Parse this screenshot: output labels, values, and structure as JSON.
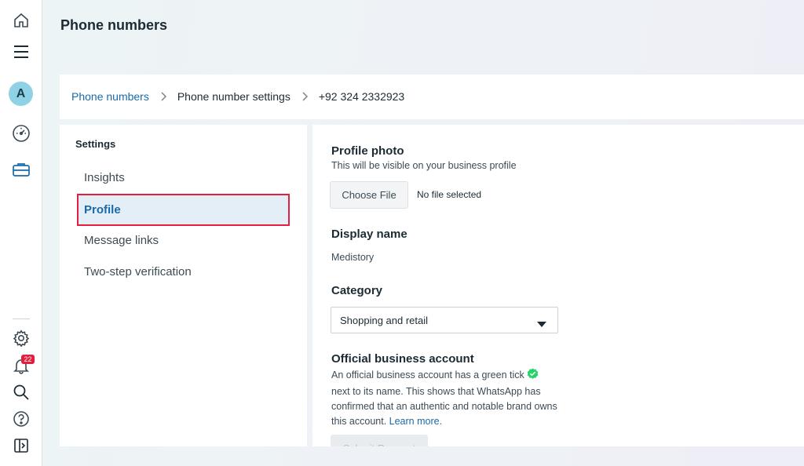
{
  "header": {
    "title": "Phone numbers"
  },
  "rail": {
    "avatar_initial": "A",
    "notification_count": "22"
  },
  "breadcrumb": {
    "items": [
      "Phone numbers",
      "Phone number settings",
      "+92 324 2332923"
    ]
  },
  "settings": {
    "heading": "Settings",
    "items": [
      {
        "label": "Insights"
      },
      {
        "label": "Profile",
        "active": true
      },
      {
        "label": "Message links"
      },
      {
        "label": "Two-step verification"
      }
    ]
  },
  "profile": {
    "photo": {
      "title": "Profile photo",
      "description": "This will be visible on your business profile",
      "choose_file_label": "Choose File",
      "file_status": "No file selected"
    },
    "display_name": {
      "title": "Display name",
      "value": "Medistory"
    },
    "category": {
      "title": "Category",
      "selected": "Shopping and retail"
    },
    "official": {
      "title": "Official business account",
      "description_part1": "An official business account has a green tick",
      "description_part2": " next to its name. This shows that WhatsApp has confirmed that an authentic and notable brand owns this account. ",
      "learn_more": "Learn more.",
      "submit_label": "Submit Request"
    }
  },
  "colors": {
    "accent_blue": "#1a6aa8",
    "highlight_red": "#e41e3f",
    "verified_green": "#25d366"
  }
}
